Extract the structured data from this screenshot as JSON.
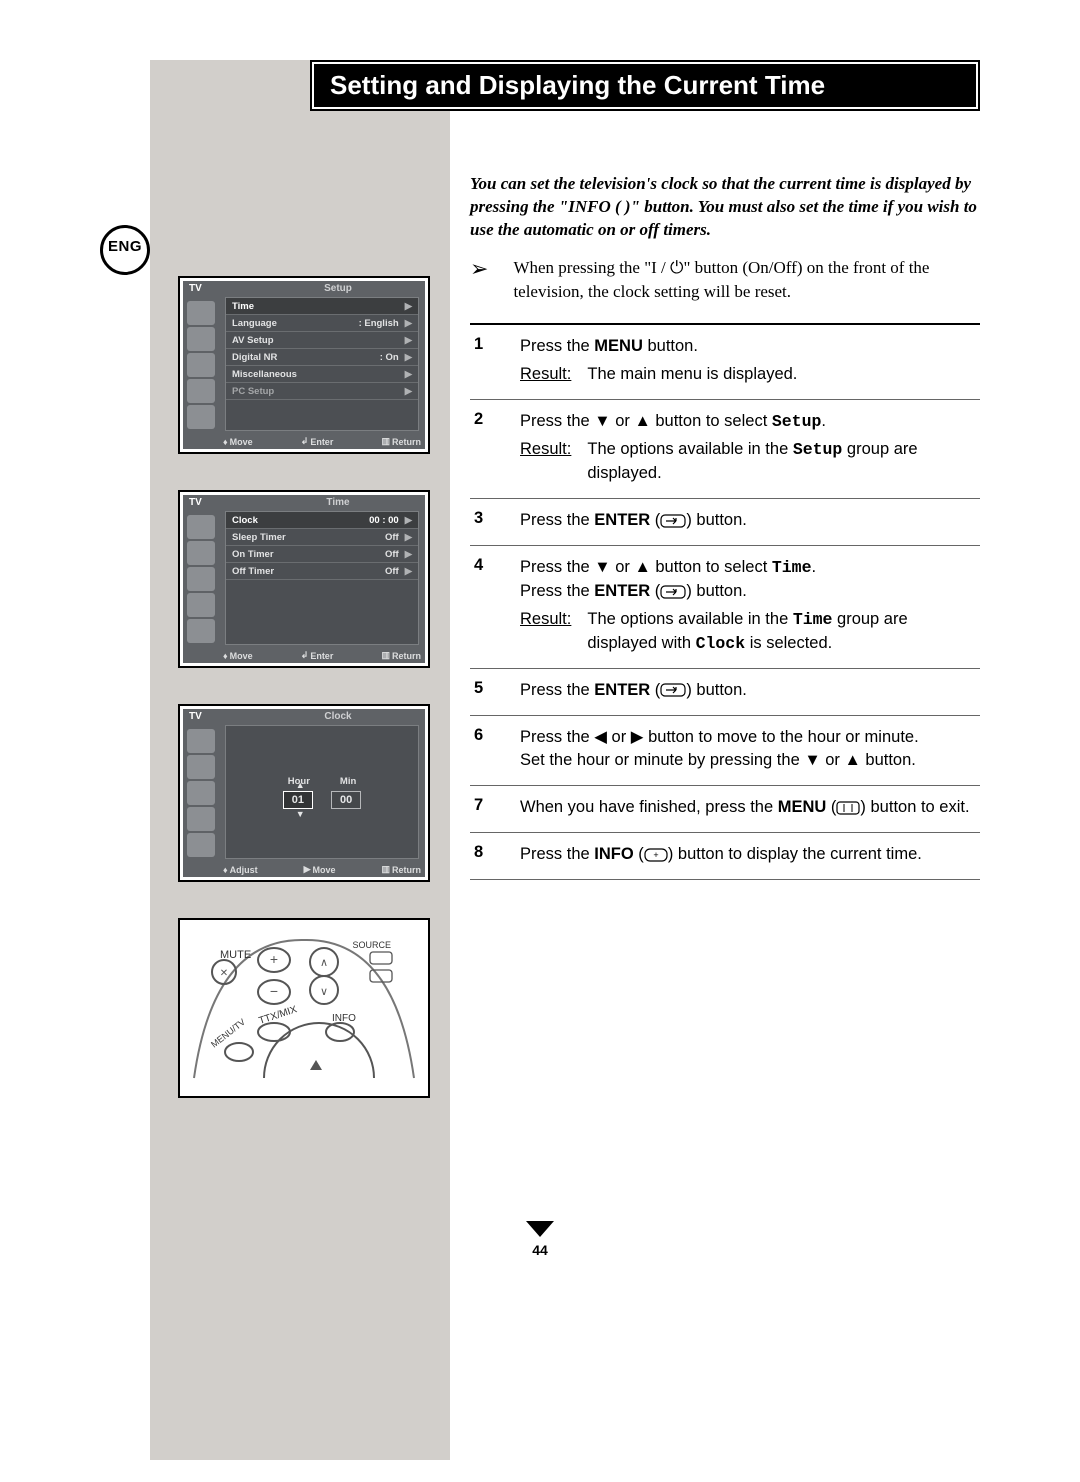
{
  "lang_badge": "ENG",
  "title": "Setting and Displaying the Current Time",
  "intro": "You can set the television's clock so that the current time is displayed by pressing the \"INFO (    )\" button. You must also set the time if you wish to use the automatic on or off timers.",
  "note": "When pressing the \"I / ⏻\" button (On/Off) on the front of the television, the clock setting will be reset.",
  "osd1": {
    "tv": "TV",
    "title": "Setup",
    "rows": [
      {
        "label": "Time",
        "val": "",
        "sel": true
      },
      {
        "label": "Language",
        "val": ": English"
      },
      {
        "label": "AV Setup",
        "val": ""
      },
      {
        "label": "Digital NR",
        "val": ": On"
      },
      {
        "label": "Miscellaneous",
        "val": ""
      },
      {
        "label": "PC Setup",
        "val": "",
        "dim": true
      }
    ],
    "footer": {
      "a": "Move",
      "b": "Enter",
      "c": "Return"
    }
  },
  "osd2": {
    "tv": "TV",
    "title": "Time",
    "rows": [
      {
        "label": "Clock",
        "val": "00 : 00",
        "sel": true
      },
      {
        "label": "Sleep Timer",
        "val": "Off"
      },
      {
        "label": "On Timer",
        "val": "Off"
      },
      {
        "label": "Off Timer",
        "val": "Off"
      }
    ],
    "footer": {
      "a": "Move",
      "b": "Enter",
      "c": "Return"
    }
  },
  "osd3": {
    "tv": "TV",
    "title": "Clock",
    "hour_label": "Hour",
    "min_label": "Min",
    "hour_val": "01",
    "min_val": "00",
    "footer": {
      "a": "Adjust",
      "b": "Move",
      "c": "Return"
    }
  },
  "remote_labels": {
    "mute": "MUTE",
    "source": "SOURCE",
    "ttx": "TTX/MIX",
    "info": "INFO",
    "menu": "MENU/TV"
  },
  "steps": [
    {
      "n": "1",
      "body": "Press the <b>MENU</b> button.",
      "result": "The main menu is displayed."
    },
    {
      "n": "2",
      "body": "Press the ▼ or ▲ button to select <span class=\"mono\">Setup</span>.",
      "result": "The options available in the <span class=\"mono\">Setup</span> group are displayed."
    },
    {
      "n": "3",
      "body": "Press the <b>ENTER</b> (<svg class=\"inline-icon\" width=\"26\" height=\"14\"><rect x=\"1\" y=\"1\" width=\"24\" height=\"12\" rx=\"4\" fill=\"none\" stroke=\"#000\" stroke-width=\"1.2\"/><path d=\"M6 7 h10 m0 0 l-3 -3 m3 3 l-3 3 M16 4 v3\" fill=\"none\" stroke=\"#000\" stroke-width=\"1.2\"/></svg>) button."
    },
    {
      "n": "4",
      "body": "Press the ▼ or ▲ button to select <span class=\"mono\">Time</span>.<br>Press the <b>ENTER</b> (<svg class=\"inline-icon\" width=\"26\" height=\"14\"><rect x=\"1\" y=\"1\" width=\"24\" height=\"12\" rx=\"4\" fill=\"none\" stroke=\"#000\" stroke-width=\"1.2\"/><path d=\"M6 7 h10 m0 0 l-3 -3 m3 3 l-3 3 M16 4 v3\" fill=\"none\" stroke=\"#000\" stroke-width=\"1.2\"/></svg>) button.",
      "result": "The options available in the <span class=\"mono\">Time</span> group are displayed with <span class=\"mono\">Clock</span> is selected."
    },
    {
      "n": "5",
      "body": "Press the <b>ENTER</b> (<svg class=\"inline-icon\" width=\"26\" height=\"14\"><rect x=\"1\" y=\"1\" width=\"24\" height=\"12\" rx=\"4\" fill=\"none\" stroke=\"#000\" stroke-width=\"1.2\"/><path d=\"M6 7 h10 m0 0 l-3 -3 m3 3 l-3 3 M16 4 v3\" fill=\"none\" stroke=\"#000\" stroke-width=\"1.2\"/></svg>) button."
    },
    {
      "n": "6",
      "body": "Press the ◀ or ▶ button to move to the hour or minute.<br>Set the hour or minute by pressing the ▼ or ▲ button."
    },
    {
      "n": "7",
      "body": "When you have finished, press the <b>MENU</b> (<svg class=\"inline-icon\" width=\"24\" height=\"14\"><rect x=\"1\" y=\"1\" width=\"22\" height=\"12\" rx=\"3\" fill=\"none\" stroke=\"#000\" stroke-width=\"1.2\"/><line x1=\"8\" y1=\"3\" x2=\"8\" y2=\"11\" stroke=\"#000\" stroke-width=\"1\"/><line x1=\"16\" y1=\"3\" x2=\"16\" y2=\"11\" stroke=\"#000\" stroke-width=\"1\"/></svg>) button to exit."
    },
    {
      "n": "8",
      "body": "Press the <b>INFO</b> (<svg class=\"inline-icon\" width=\"24\" height=\"14\"><rect x=\"1\" y=\"1\" width=\"22\" height=\"12\" rx=\"5\" fill=\"none\" stroke=\"#000\" stroke-width=\"1.2\"/><text x=\"12\" y=\"10\" font-size=\"9\" text-anchor=\"middle\" fill=\"#000\">+</text></svg>) button to display the current time."
    }
  ],
  "page_number": "44"
}
